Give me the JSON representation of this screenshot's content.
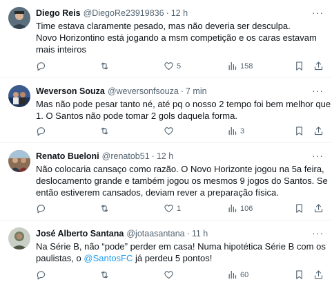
{
  "tweets": [
    {
      "name": "Diego Reis",
      "handle": "@DiegoRe23919836",
      "separator": "·",
      "time": "12 h",
      "lines": [
        "Time estava claramente pesado, mas não deveria ser desculpa.",
        "Novo Horizontino está jogando a msm competição e os caras estavam",
        "mais inteiros"
      ],
      "replies": "",
      "retweets": "",
      "likes": "5",
      "views": "158",
      "avatar_color": "#5b6e7c"
    },
    {
      "name": "Weverson Souza",
      "handle": "@weversonfsouza",
      "separator": "·",
      "time": "7 min",
      "lines": [
        "Mas não pode pesar tanto né, até pq o nosso 2 tempo foi bem melhor que o",
        "1. O Santos não pode tomar 2 gols daquela forma."
      ],
      "replies": "",
      "retweets": "",
      "likes": "",
      "views": "3",
      "avatar_color": "#3b5b8f"
    },
    {
      "name": "Renato Bueloni",
      "handle": "@renatob51",
      "separator": "·",
      "time": "12 h",
      "lines": [
        "Não colocaria cansaço como razão. O Novo Horizonte jogou na 5a feira,",
        "deslocamento grande e também jogou os mesmos 9 jogos do Santos. Se",
        "então estiverem cansados, deviam rever a preparação física."
      ],
      "replies": "",
      "retweets": "",
      "likes": "1",
      "views": "106",
      "avatar_color": "#8a6d55"
    },
    {
      "name": "José Alberto Santana",
      "handle": "@jotaasantana",
      "separator": "·",
      "time": "11 h",
      "lines": [
        "Na Série B, não “pode” perder em casa! Numa hipotética Série B com os",
        "paulistas, o ",
        "já perdeu 5 pontos!"
      ],
      "mention": "@SantosFC",
      "replies": "",
      "retweets": "",
      "likes": "",
      "views": "60",
      "avatar_color": "#6f7a62"
    }
  ],
  "more_icon": "···",
  "colors": {
    "text": "#0f1419",
    "secondary": "#536471",
    "link": "#1d9bf0",
    "divider": "#eff3f4"
  },
  "icons": [
    "reply-icon",
    "retweet-icon",
    "like-icon",
    "views-icon",
    "bookmark-icon",
    "share-icon",
    "more-icon"
  ]
}
